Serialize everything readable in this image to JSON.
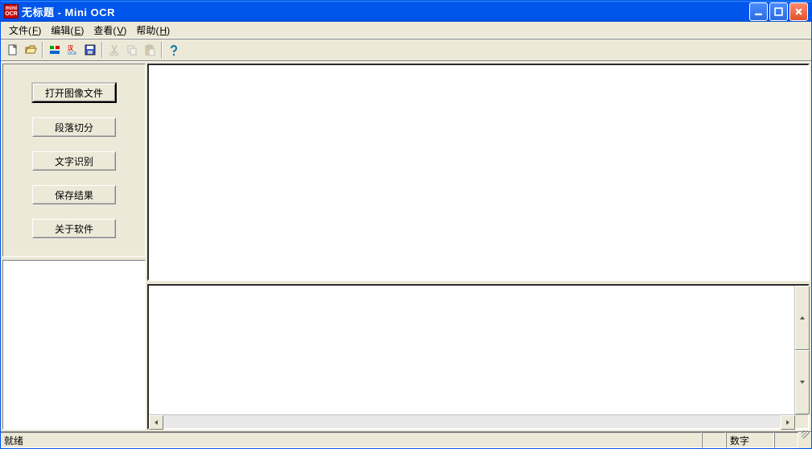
{
  "title": "无标题 - Mini OCR",
  "menu": {
    "file": {
      "label": "文件",
      "accel": "F"
    },
    "edit": {
      "label": "编辑",
      "accel": "E"
    },
    "view": {
      "label": "查看",
      "accel": "V"
    },
    "help": {
      "label": "帮助",
      "accel": "H"
    }
  },
  "toolbar": {
    "new": "new",
    "open": "open",
    "lang": "lang",
    "ocr": "ocr",
    "save": "save",
    "cut": "cut",
    "copy": "copy",
    "paste": "paste",
    "about": "about"
  },
  "sidebar": {
    "open_image": "打开图像文件",
    "segment": "段落切分",
    "recognize": "文字识别",
    "save_result": "保存结果",
    "about": "关于软件"
  },
  "status": {
    "ready": "就绪",
    "num": "数字"
  }
}
